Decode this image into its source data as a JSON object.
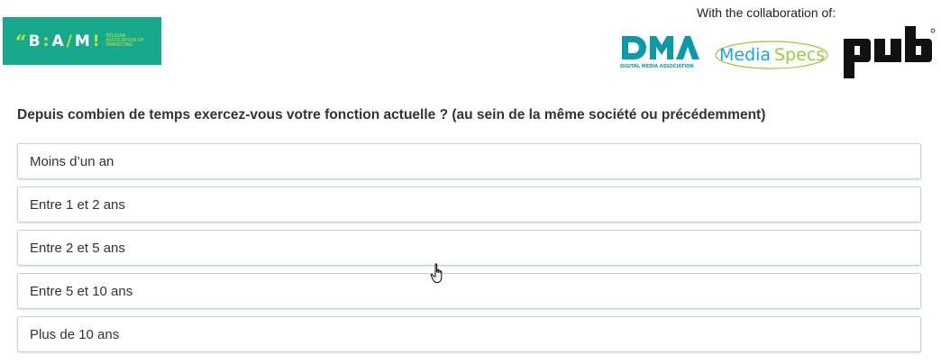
{
  "header": {
    "bam_logo": {
      "text": "B:A/M!",
      "subtitle": "Belgian Association of Marketing",
      "bg_color": "#17a98b",
      "accent_color": "#c7e23a"
    },
    "collab_label": "With the collaboration of:",
    "partners": [
      {
        "name": "DMA",
        "caption": "DIGITAL MEDIA ASSOCIATION",
        "color": "#0a9aa8"
      },
      {
        "name": "MediaSpecs",
        "color": "#1aa6d6",
        "accent": "#9ccb3b"
      },
      {
        "name": "pub",
        "color": "#111111"
      }
    ]
  },
  "question": {
    "text": "Depuis combien de temps exercez-vous votre fonction actuelle ? (au sein de la même société ou précédemment)",
    "options": [
      {
        "label": "Moins d’un an"
      },
      {
        "label": "Entre 1 et 2 ans"
      },
      {
        "label": "Entre 2 et 5 ans"
      },
      {
        "label": "Entre 5 et 10 ans"
      },
      {
        "label": "Plus de 10 ans"
      }
    ]
  },
  "cursor": {
    "type": "hand-pointer"
  }
}
